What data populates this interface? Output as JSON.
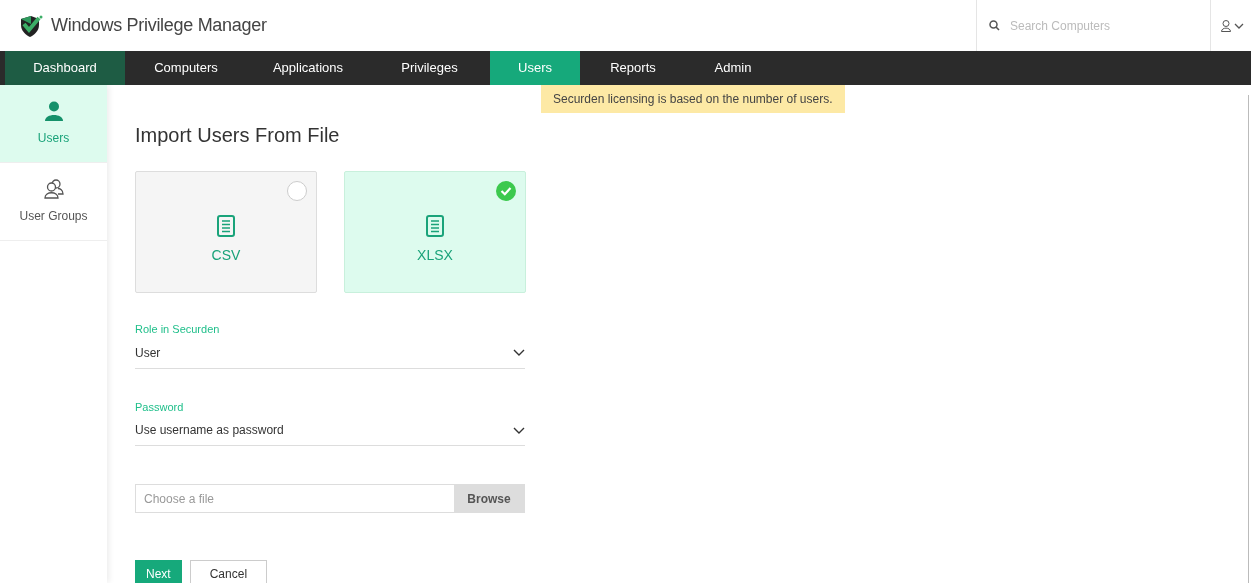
{
  "app": {
    "title": "Windows Privilege Manager"
  },
  "search": {
    "placeholder": "Search Computers"
  },
  "nav": [
    {
      "label": "Dashboard",
      "kind": "home",
      "selected": false
    },
    {
      "label": "Computers",
      "kind": "tab",
      "selected": false
    },
    {
      "label": "Applications",
      "kind": "tab",
      "selected": false
    },
    {
      "label": "Privileges",
      "kind": "tab",
      "selected": false
    },
    {
      "label": "Users",
      "kind": "tab",
      "selected": true
    },
    {
      "label": "Reports",
      "kind": "tab",
      "selected": false
    },
    {
      "label": "Admin",
      "kind": "tab",
      "selected": false
    }
  ],
  "tooltip": "Securden licensing is based on the number of users.",
  "sidebar": {
    "items": [
      {
        "label": "Users",
        "kind": "user",
        "selected": true
      },
      {
        "label": "User Groups",
        "kind": "group",
        "selected": false
      }
    ]
  },
  "page": {
    "title": "Import Users From File",
    "formats": [
      {
        "label": "CSV",
        "selected": false
      },
      {
        "label": "XLSX",
        "selected": true
      }
    ],
    "fields": [
      {
        "label": "Role in Securden",
        "value": "User"
      },
      {
        "label": "Password",
        "value": "Use username as password"
      }
    ],
    "file": {
      "placeholder": "Choose a file",
      "button": "Browse"
    },
    "buttons": [
      {
        "label": "Next",
        "kind": "primary"
      },
      {
        "label": "Cancel",
        "kind": "secondary"
      }
    ]
  }
}
